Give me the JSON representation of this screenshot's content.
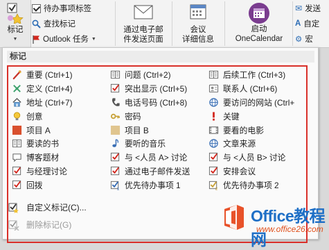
{
  "ribbon": {
    "tag_label": "标记",
    "todo_tag": "待办事项标签",
    "find_tags": "查找标记",
    "outlook_tasks": "Outlook 任务",
    "email_label": [
      "通过电子邮",
      "件发送页面"
    ],
    "meeting_label": [
      "会议",
      "详细信息"
    ],
    "onecalendar_label": [
      "启动",
      "OneCalendar"
    ],
    "send_label": "发送",
    "auto_label": "自定",
    "macro_label": "宏"
  },
  "menu": {
    "header": "标记",
    "tags": [
      {
        "label": "重要 (Ctrl+1)",
        "icon": "star-icon"
      },
      {
        "label": "问题 (Ctrl+2)",
        "icon": "book-icon"
      },
      {
        "label": "后续工作 (Ctrl+3)",
        "icon": "book-icon"
      },
      {
        "label": "定义 (Ctrl+4)",
        "icon": "definition-icon"
      },
      {
        "label": "突出显示 (Ctrl+5)",
        "icon": "checkbox-icon"
      },
      {
        "label": "联系人 (Ctrl+6)",
        "icon": "contact-icon"
      },
      {
        "label": "地址 (Ctrl+7)",
        "icon": "house-icon"
      },
      {
        "label": "电话号码 (Ctrl+8)",
        "icon": "phone-icon"
      },
      {
        "label": "要访问的网站 (Ctrl+",
        "icon": "globe-icon"
      },
      {
        "label": "创意",
        "icon": "lightbulb-icon"
      },
      {
        "label": "密码",
        "icon": "key-icon"
      },
      {
        "label": "关键",
        "icon": "exclamation-icon"
      },
      {
        "label": "项目 A",
        "icon": "red-square-icon"
      },
      {
        "label": "项目 B",
        "icon": "tan-square-icon"
      },
      {
        "label": "要看的电影",
        "icon": "film-icon"
      },
      {
        "label": "要读的书",
        "icon": "book-icon"
      },
      {
        "label": "要听的音乐",
        "icon": "music-note-icon"
      },
      {
        "label": "文章来源",
        "icon": "globe-icon"
      },
      {
        "label": "博客题材",
        "icon": "speech-bubble-icon"
      },
      {
        "label": "与 <人员 A> 讨论",
        "icon": "checkbox-icon"
      },
      {
        "label": "与 <人员 B> 讨论",
        "icon": "checkbox-icon"
      },
      {
        "label": "与经理讨论",
        "icon": "checkbox-icon"
      },
      {
        "label": "通过电子邮件发送",
        "icon": "checkbox-icon"
      },
      {
        "label": "安排会议",
        "icon": "checkbox-icon"
      },
      {
        "label": "回拨",
        "icon": "checkbox-icon"
      },
      {
        "label": "优先待办事项 1",
        "icon": "priority-1-icon"
      },
      {
        "label": "优先待办事项 2",
        "icon": "priority-2-icon"
      }
    ],
    "custom_tags": "自定义标记(C)...",
    "remove_tag": "删除标记(G)"
  },
  "watermark": {
    "title": "Office教程网",
    "url": "www.office26.com"
  },
  "colors": {
    "highlight_border": "#d9302a",
    "brand_blue": "#1e6fc6",
    "brand_orange": "#e04f1a"
  }
}
